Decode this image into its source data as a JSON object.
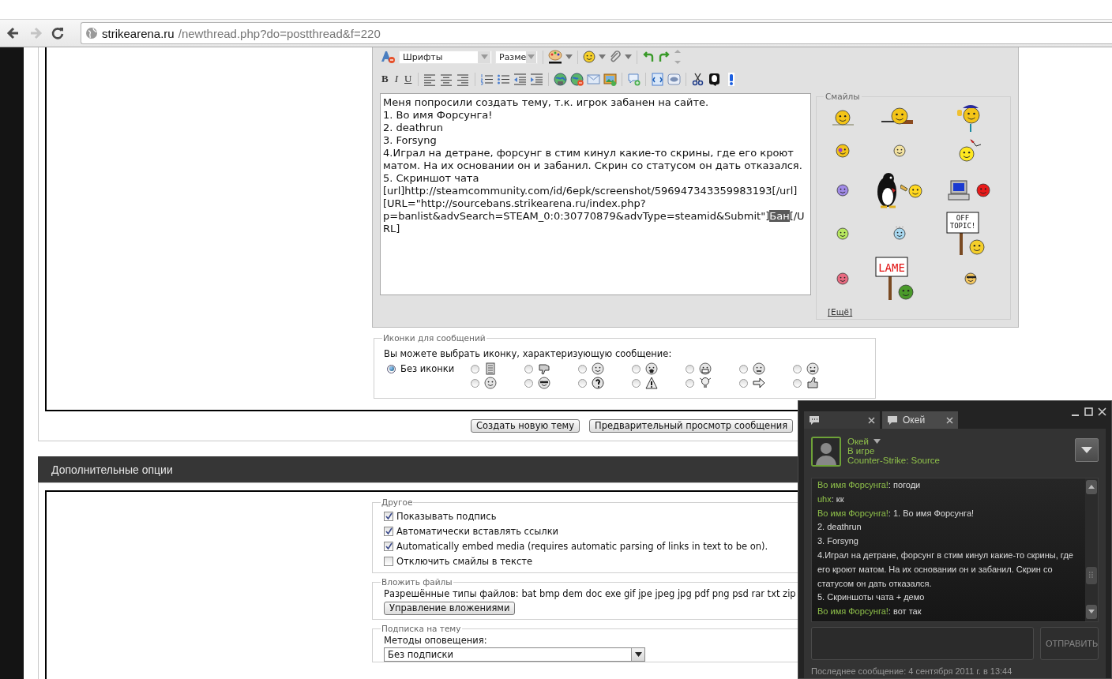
{
  "browser": {
    "url_host": "strikearena.ru",
    "url_path": "/newthread.php?do=postthread&f=220",
    "forward_disabled": true
  },
  "editor": {
    "font_select": "Шрифты",
    "size_select": "Разме",
    "format_buttons": [
      "B",
      "I",
      "U"
    ],
    "text_before_selection": "Меня попросили создать тему, т.к. игрок забанен на сайте.\n1. Во имя Форсунга!\n2. deathrun\n3. Forsyng\n4.Играл на детране, форсунг в стим кинул какие-то скрины, где его кроют матом. На их основании он и забанил. Скрин со статусом он дать отказался.\n5. Скриншот чата\n[url]http://steamcommunity.com/id/6epk/screenshot/596947343359983193[/url]\n[URL=\"http://sourcebans.strikearena.ru/index.php?p=banlist&advSearch=STEAM_0:0:30770879&advType=steamid&Submit\"]",
    "selected_text": "Бан",
    "text_after_selection": "[/URL]",
    "smilies": {
      "legend": "Смайлы",
      "signs": [
        {
          "lines": [
            "OFF",
            "TOPIC!"
          ]
        },
        {
          "lines": [
            "LAME"
          ]
        }
      ],
      "more_link": "[Ещё]"
    }
  },
  "post_icons": {
    "legend": "Иконки для сообщений",
    "prompt": "Вы можете выбрать иконку, характеризующую сообщение:",
    "options": [
      {
        "label": "Без иконки",
        "selected": true
      },
      {
        "selected": false
      },
      {
        "selected": false
      },
      {
        "selected": false
      },
      {
        "selected": false
      },
      {
        "selected": false
      },
      {
        "selected": false
      },
      {
        "selected": false
      },
      {
        "selected": false
      },
      {
        "selected": false
      },
      {
        "selected": false
      },
      {
        "selected": false
      },
      {
        "selected": false
      },
      {
        "selected": false
      },
      {
        "selected": false
      }
    ]
  },
  "buttons": [
    "Создать новую тему",
    "Предварительный просмотр сообщения"
  ],
  "additional_options": {
    "title": "Дополнительные опции",
    "other": {
      "legend": "Другое",
      "checkboxes": [
        {
          "label": "Показывать подпись",
          "checked": true
        },
        {
          "label": "Автоматически вставлять ссылки",
          "checked": true
        },
        {
          "label": "Automatically embed media (requires automatic parsing of links in text to be on).",
          "checked": true
        },
        {
          "label": "Отключить смайлы в тексте",
          "checked": false
        }
      ]
    },
    "attachments": {
      "legend": "Вложить файлы",
      "allowed_types": "Разрешённые типы файлов: bat bmp dem doc exe gif jpe jpeg jpg pdf png psd rar txt zip",
      "button": "Управление вложениями"
    },
    "subscription": {
      "legend": "Подписка на тему",
      "label": "Методы оповещения:",
      "value": "Без подписки"
    }
  },
  "chat": {
    "tabs": [
      {
        "selected": false
      },
      {
        "label": "Окей",
        "selected": true
      }
    ],
    "friend": {
      "name": "Окей",
      "status": "В игре",
      "game": "Counter-Strike: Source"
    },
    "messages": [
      {
        "sender": "Во имя Форсунга!",
        "text": ": погоди"
      },
      {
        "sender": "uhx",
        "text": ": кк"
      },
      {
        "sender": "Во имя Форсунга!",
        "text": ": 1. Во имя Форсунга!"
      },
      {
        "text": "2. deathrun"
      },
      {
        "text": "3. Forsyng"
      },
      {
        "text": "4.Играл на детране, форсунг в стим кинул какие-то скрины, где его кроют матом. На их основании он и забанил. Скрин со статусом он дать отказался."
      },
      {
        "text": "5. Скриншоты чата + демо"
      },
      {
        "sender": "Во имя Форсунга!",
        "text": ": вот так"
      }
    ],
    "send_button": "ОТПРАВИТЬ",
    "footer": "Последнее сообщение: 4 сентября 2011 г. в 13:44"
  }
}
